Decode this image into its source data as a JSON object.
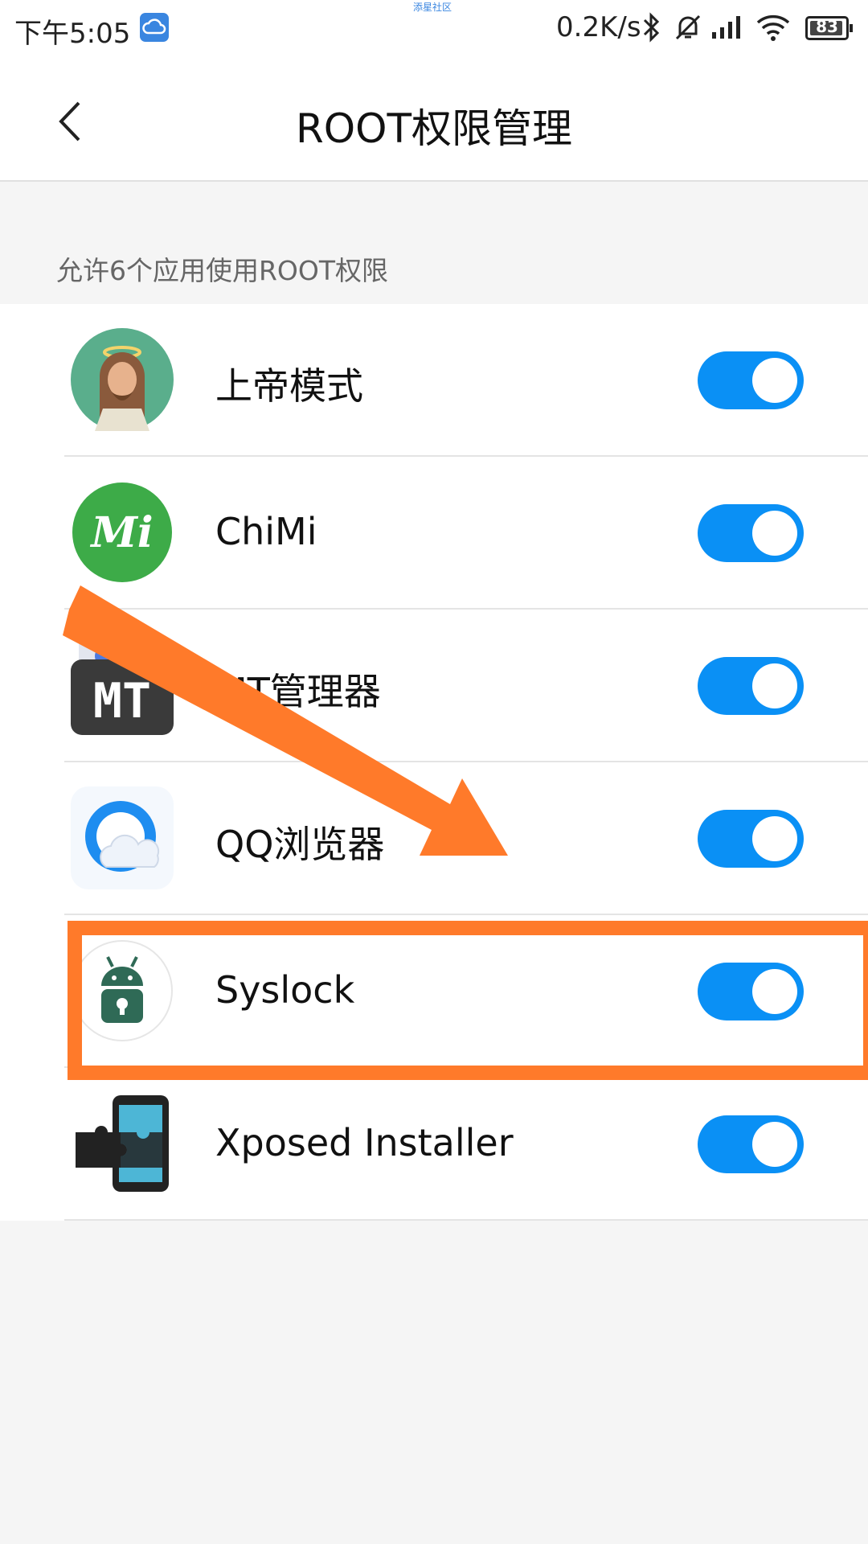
{
  "status_bar": {
    "time": "下午5:05",
    "watermark": "添星社区",
    "net_speed": "0.2K/s",
    "battery": "83",
    "icons": [
      "cloud-icon",
      "bluetooth-icon",
      "mute-icon",
      "signal-icon",
      "wifi-icon",
      "battery-icon"
    ]
  },
  "header": {
    "title": "ROOT权限管理",
    "back_icon": "chevron-left-icon"
  },
  "section": {
    "label": "允许6个应用使用ROOT权限"
  },
  "apps": [
    {
      "name": "上帝模式",
      "icon": "god-mode-icon",
      "enabled": true
    },
    {
      "name": "ChiMi",
      "icon": "chimi-icon",
      "enabled": true
    },
    {
      "name": "MT管理器",
      "icon": "mt-manager-icon",
      "enabled": true
    },
    {
      "name": "QQ浏览器",
      "icon": "qq-browser-icon",
      "enabled": true
    },
    {
      "name": "Syslock",
      "icon": "syslock-icon",
      "enabled": true
    },
    {
      "name": "Xposed Installer",
      "icon": "xposed-icon",
      "enabled": true
    }
  ],
  "colors": {
    "toggle_on": "#0a90f5",
    "annotation": "#ff7a2a"
  }
}
